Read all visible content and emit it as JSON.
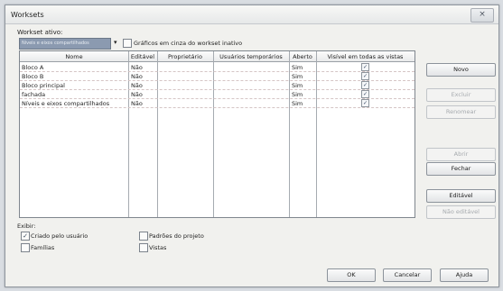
{
  "window": {
    "title": "Worksets",
    "close_glyph": "×"
  },
  "workset_active": {
    "label": "Workset ativo:",
    "value": "Níveis e eixos compartilhados",
    "dropdown_glyph": "▾",
    "gray_label": "Gráficos em cinza do workset inativo",
    "gray_checked": false
  },
  "table": {
    "headers": [
      "Nome",
      "Editável",
      "Proprietário",
      "Usuários temporários",
      "Aberto",
      "Visível em todas as vistas"
    ],
    "rows": [
      {
        "name": "Bloco A",
        "editable": "Não",
        "owner": "",
        "temp_users": "",
        "open": "Sim",
        "visible": true
      },
      {
        "name": "Bloco B",
        "editable": "Não",
        "owner": "",
        "temp_users": "",
        "open": "Sim",
        "visible": true
      },
      {
        "name": "Bloco principal",
        "editable": "Não",
        "owner": "",
        "temp_users": "",
        "open": "Sim",
        "visible": true
      },
      {
        "name": "fachada",
        "editable": "Não",
        "owner": "",
        "temp_users": "",
        "open": "Sim",
        "visible": true
      },
      {
        "name": "Níveis e eixos compartilhados",
        "editable": "Não",
        "owner": "",
        "temp_users": "",
        "open": "Sim",
        "visible": true
      }
    ]
  },
  "show": {
    "label": "Exibir:",
    "options": [
      {
        "label": "Criado pelo usuário",
        "checked": true
      },
      {
        "label": "Famílias",
        "checked": false
      },
      {
        "label": "Padrões do projeto",
        "checked": false
      },
      {
        "label": "Vistas",
        "checked": false
      }
    ]
  },
  "side_buttons": {
    "new": "Novo",
    "delete": "Excluir",
    "rename": "Renomear",
    "open": "Abrir",
    "close": "Fechar",
    "editable": "Editável",
    "not_editable": "Não editável"
  },
  "bottom_buttons": {
    "ok": "OK",
    "cancel": "Cancelar",
    "help": "Ajuda"
  },
  "check_glyph": "✓"
}
